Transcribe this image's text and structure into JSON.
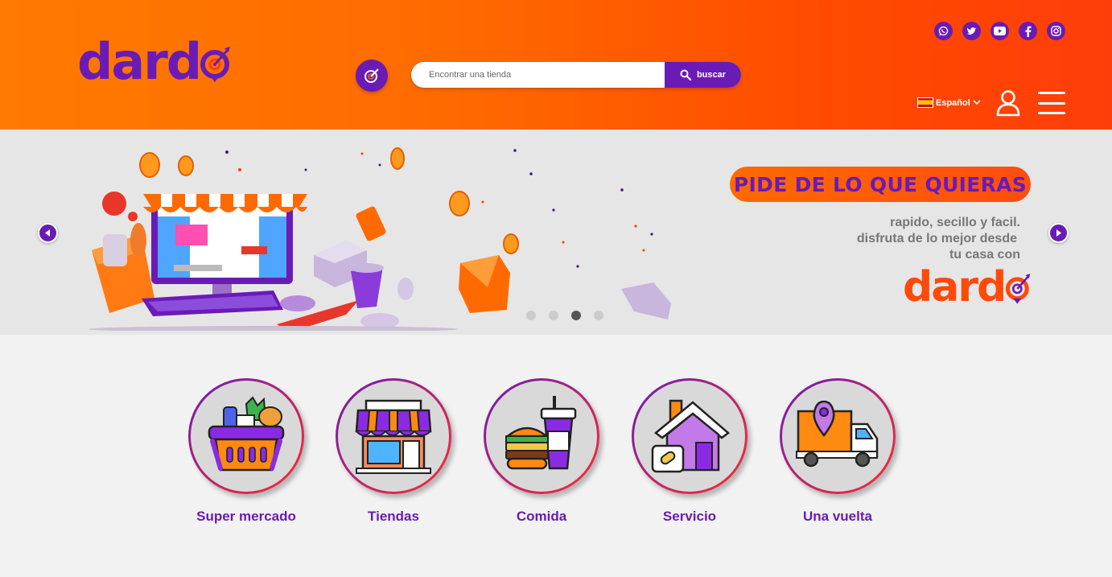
{
  "header": {
    "logo_text": "dard",
    "search": {
      "placeholder": "Encontrar una tienda",
      "button_label": "buscar"
    },
    "social": [
      "whatsapp-icon",
      "twitter-icon",
      "youtube-icon",
      "facebook-icon",
      "instagram-icon"
    ],
    "language": {
      "label": "Español",
      "flag": "spain-flag-icon"
    }
  },
  "banner": {
    "headline": "PIDE DE LO QUE QUIERAS",
    "tagline": [
      "rapido, secillo y facil.",
      "disfruta de lo mejor desde",
      "tu casa con"
    ],
    "logo_text": "dard",
    "slides_count": 4,
    "active_slide": 3
  },
  "categories": [
    {
      "label": "Super mercado",
      "icon": "basket-icon"
    },
    {
      "label": "Tiendas",
      "icon": "store-icon"
    },
    {
      "label": "Comida",
      "icon": "food-icon"
    },
    {
      "label": "Servicio",
      "icon": "home-service-icon"
    },
    {
      "label": "Una vuelta",
      "icon": "delivery-truck-icon"
    }
  ],
  "colors": {
    "brand_purple": "#6a1bb5",
    "brand_orange": "#ff6a00",
    "accent_red": "#ff3d0a"
  }
}
